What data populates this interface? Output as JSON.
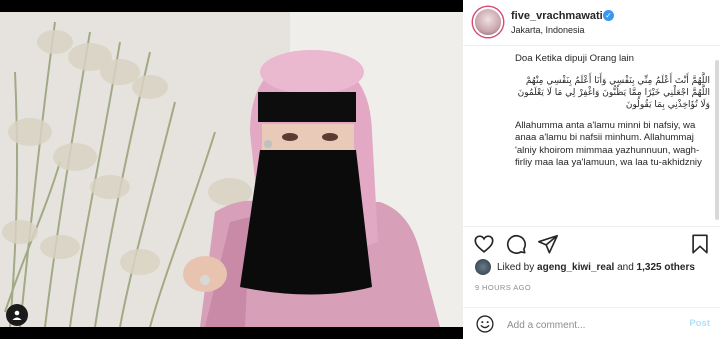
{
  "profile": {
    "username": "five_vrachmawati",
    "location": "Jakarta, Indonesia",
    "verified_icon": "verified-badge-icon",
    "more_icon": "more-options-icon"
  },
  "caption": {
    "title": "Doa Ketika dipuji Orang lain",
    "arabic": "اللَّهُمَّ أَنْتَ أَعْلَمُ مِنِّي بِنَفْسِي وَأَنَا أَعْلَمُ بِنَفْسِي مِنْهُمْ اللَّهُمَّ اجْعَلْنِي خَيْرًا مِمَّا يَظُنُّونَ وَاغْفِرْ لِي مَا لَا يَعْلَمُونَ وَلَا تُؤَاخِذْنِي بِمَا يَقُولُونَ",
    "latin": "Allahumma anta a'lamu minni bi nafsiy, wa anaa a'lamu bi nafsii minhum. Allahummaj 'alniy khoirom mimmaa yazhunnuun, wagh-firliy maa laa ya'lamuun, wa laa tu-akhidzniy"
  },
  "actions": {
    "like_icon": "heart-icon",
    "comment_icon": "comment-icon",
    "share_icon": "share-icon",
    "save_icon": "bookmark-icon"
  },
  "likes": {
    "prefix": "Liked by ",
    "user": "ageng_kiwi_real",
    "middle": " and ",
    "others": "1,325 others"
  },
  "timestamp": "9 HOURS AGO",
  "comment_box": {
    "placeholder": "Add a comment...",
    "post_label": "Post"
  },
  "colors": {
    "accent": "#3897f0",
    "post_disabled": "#b2dffc",
    "text": "#262626",
    "muted": "#8e8e8e"
  }
}
